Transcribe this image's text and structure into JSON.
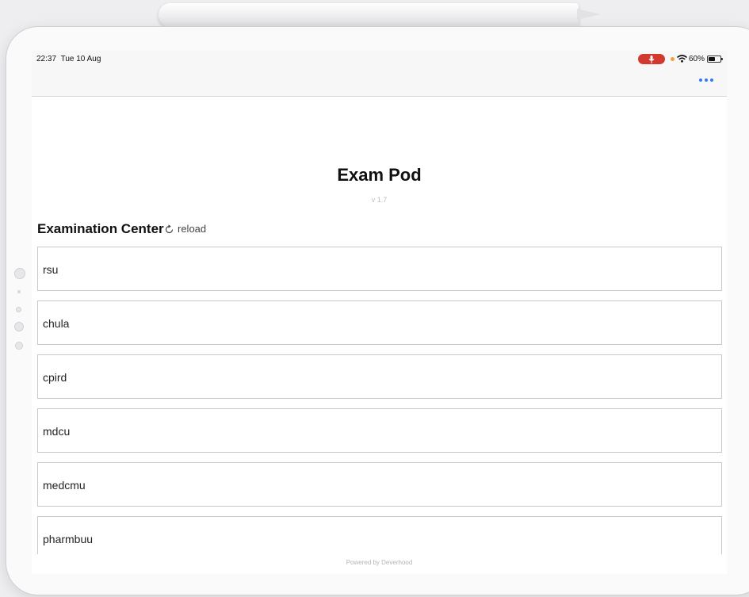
{
  "status_bar": {
    "time": "22:37",
    "date": "Tue 10 Aug",
    "battery_text": "60%",
    "battery_level": 0.6,
    "mic_active_color": "#d23a30",
    "privacy_dot_color": "#f2a03d"
  },
  "nav": {
    "more_icon": "ellipsis-icon",
    "accent_color": "#3478f6"
  },
  "app": {
    "title": "Exam Pod",
    "version": "v 1.7"
  },
  "section": {
    "title": "Examination Center",
    "reload_label": "reload",
    "reload_icon": "refresh-icon"
  },
  "centers": [
    "rsu",
    "chula",
    "cpird",
    "mdcu",
    "medcmu",
    "pharmbuu"
  ],
  "footer": {
    "text": "Powered by Deverhood"
  }
}
